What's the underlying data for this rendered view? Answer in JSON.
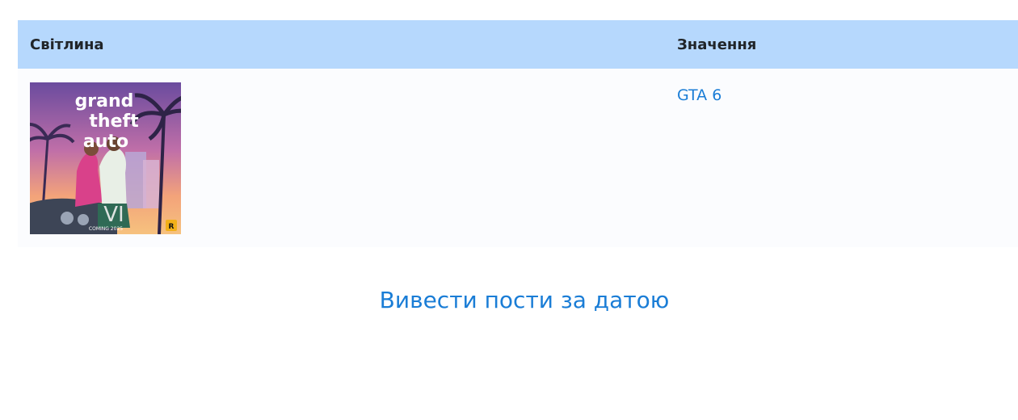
{
  "table": {
    "headers": {
      "photo": "Світлина",
      "value": "Значення"
    },
    "rows": [
      {
        "image_alt": "GTA 6 cover",
        "image_text": "grand theft auto",
        "image_badge": "COMING 2025",
        "value": "GTA 6"
      }
    ]
  },
  "actions": {
    "show_posts_by_date": "Вивести пости за датою"
  },
  "colors": {
    "header_bg": "#b6d8fd",
    "link": "#1a7dd6",
    "row_bg": "#fbfcfe"
  }
}
